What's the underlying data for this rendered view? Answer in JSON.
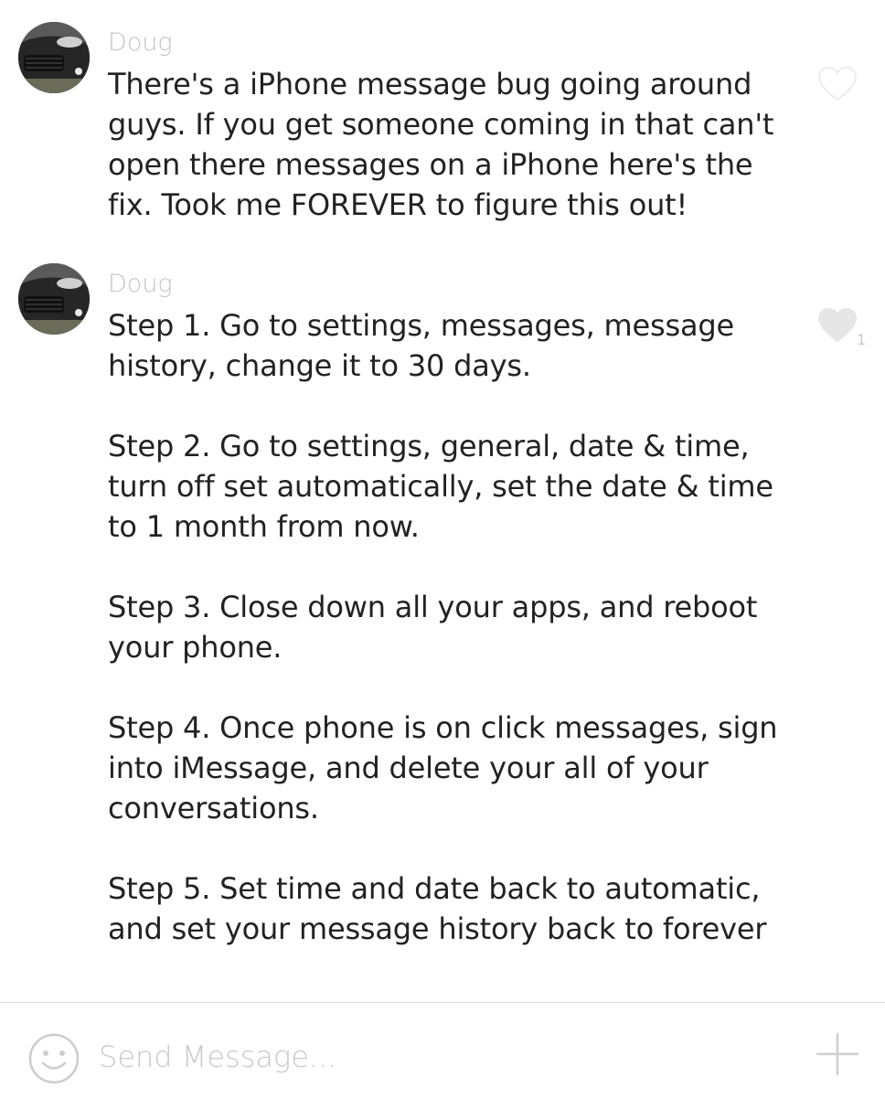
{
  "messages": [
    {
      "sender": "Doug",
      "avatar_icon": "car-photo-avatar",
      "paragraphs": [
        "There's a iPhone message bug going around\nguys. If you get someone coming in that can't\nopen there messages on a iPhone here's the\nfix. Took me FOREVER to figure this out!"
      ],
      "liked": false,
      "like_count": ""
    },
    {
      "sender": "Doug",
      "avatar_icon": "car-photo-avatar",
      "paragraphs": [
        "Step 1. Go to settings, messages, message\nhistory, change it to 30 days.",
        "Step 2. Go to settings, general, date & time,\nturn off set automatically, set the date & time\nto 1 month from now.",
        "Step 3. Close down all your apps, and reboot\nyour phone.",
        "Step 4. Once phone is on click messages, sign\ninto iMessage, and delete your all of your\nconversations.",
        "Step 5. Set time and date back to automatic,\nand set your message history back to forever"
      ],
      "liked": true,
      "like_count": "1"
    }
  ],
  "composer": {
    "placeholder": "Send Message...",
    "emoji_icon": "smiley-face-icon",
    "add_icon": "plus-icon"
  },
  "colors": {
    "sender_gray": "#c4c4c4",
    "heart_outline": "#ececec",
    "heart_filled": "#e6e6e6",
    "divider": "#d9d9d9"
  }
}
